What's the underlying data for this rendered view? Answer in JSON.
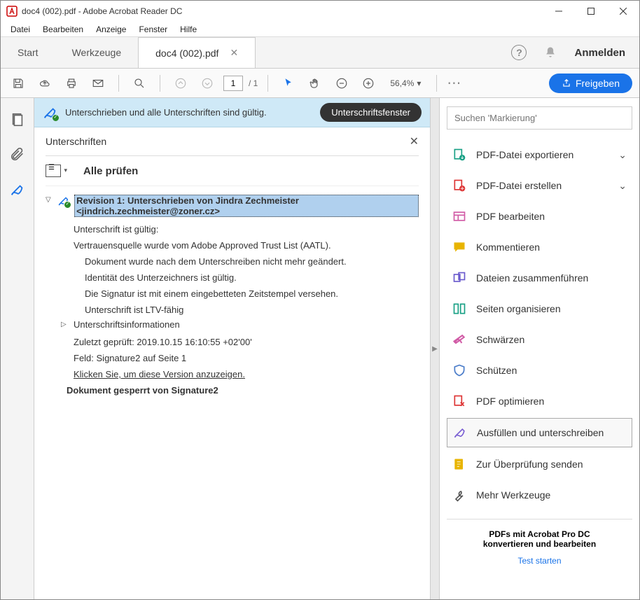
{
  "window": {
    "title": "doc4 (002).pdf - Adobe Acrobat Reader DC"
  },
  "menu": {
    "file": "Datei",
    "edit": "Bearbeiten",
    "view": "Anzeige",
    "window": "Fenster",
    "help": "Hilfe"
  },
  "tabs": {
    "start": "Start",
    "tools": "Werkzeuge",
    "doc": "doc4 (002).pdf",
    "signin": "Anmelden"
  },
  "toolbar": {
    "page_current": "1",
    "page_total": "/ 1",
    "zoom": "56,4%",
    "share": "Freigeben"
  },
  "sigbar": {
    "msg": "Unterschrieben und alle Unterschriften sind gültig.",
    "btn": "Unterschriftsfenster"
  },
  "sigpanel": {
    "title": "Unterschriften",
    "checkall": "Alle prüfen",
    "revision": "Revision 1: Unterschrieben von Jindra Zechmeister <jindrich.zechmeister@zoner.cz>",
    "l1": "Unterschrift ist gültig:",
    "l2": "Vertrauensquelle wurde vom Adobe Approved Trust List (AATL).",
    "l3": "Dokument wurde nach dem Unterschreiben nicht mehr geändert.",
    "l4": "Identität des Unterzeichners ist gültig.",
    "l5": "Die Signatur ist mit einem eingebetteten Zeitstempel versehen.",
    "l6": "Unterschrift ist LTV-fähig",
    "l7": "Unterschriftsinformationen",
    "l8": "Zuletzt geprüft: 2019.10.15 16:10:55 +02'00'",
    "l9": "Feld: Signature2 auf Seite 1",
    "l10": "Klicken Sie, um diese Version anzuzeigen.",
    "l11": "Dokument gesperrt von Signature2"
  },
  "right": {
    "search_placeholder": "Suchen 'Markierung'",
    "t1": "PDF-Datei exportieren",
    "t2": "PDF-Datei erstellen",
    "t3": "PDF bearbeiten",
    "t4": "Kommentieren",
    "t5": "Dateien zusammenführen",
    "t6": "Seiten organisieren",
    "t7": "Schwärzen",
    "t8": "Schützen",
    "t9": "PDF optimieren",
    "t10": "Ausfüllen und unterschreiben",
    "t11": "Zur Überprüfung senden",
    "t12": "Mehr Werkzeuge",
    "promo1": "PDFs mit Acrobat Pro DC",
    "promo2": "konvertieren und bearbeiten",
    "promo_link": "Test starten"
  }
}
